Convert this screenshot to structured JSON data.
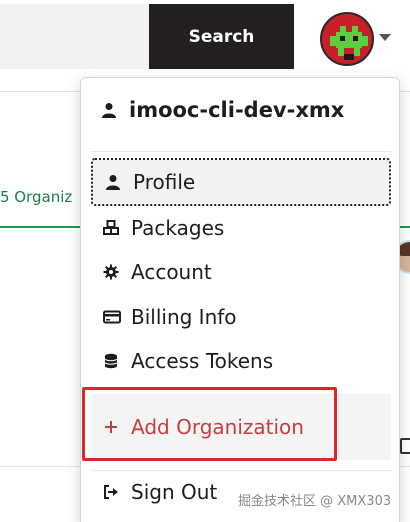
{
  "header": {
    "search_label": "Search",
    "avatar_icon": "pixel-invader-avatar"
  },
  "background": {
    "orgs_tab": "5 Organiz"
  },
  "menu": {
    "username": "imooc-cli-dev-xmx",
    "items": [
      {
        "label": "Profile",
        "icon": "user-icon",
        "active": true
      },
      {
        "label": "Packages",
        "icon": "cubes-icon"
      },
      {
        "label": "Account",
        "icon": "gear-icon"
      },
      {
        "label": "Billing Info",
        "icon": "credit-card-icon"
      },
      {
        "label": "Access Tokens",
        "icon": "coins-icon"
      },
      {
        "label": "Add Organization",
        "icon": "plus-icon",
        "color": "#c53f3f"
      },
      {
        "label": "Sign Out",
        "icon": "sign-out-icon"
      }
    ]
  },
  "watermark": "掘金技术社区 @ XMX303",
  "colors": {
    "accent_red": "#c53f3f",
    "highlight_border": "#e0252a",
    "search_bg": "#231f20",
    "avatar_red": "#c8202a",
    "avatar_green": "#5ccf3e",
    "tab_green": "#1b9a54"
  }
}
